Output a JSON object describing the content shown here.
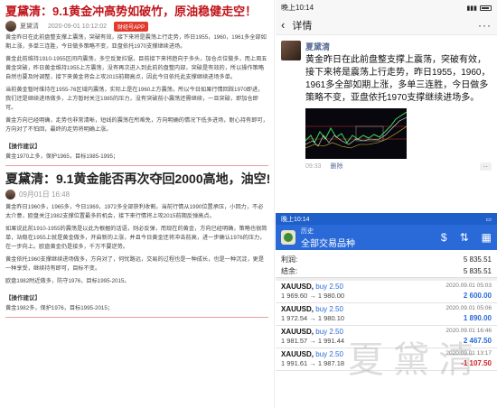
{
  "article1": {
    "title": "夏黛清：9.1黄金冲高势如破竹，原油稳健走空！",
    "author": "夏黛清",
    "date": "2020-09-01 10:12:02",
    "badge": "财经号APP",
    "paragraphs": [
      "黄金昨日在此前盘整支撑上震荡，突破有效，接下来将是震荡上行走势，昨日1955，1960，1961多全部如期上涨，多单三连胜，今日做多策略不变，亚盘依托1970支撑继续进场。",
      "黄金此前维持1910-1955区间内震荡，多空反复拉锯，目前接下来将趋向于多头，加仓点位做多，而上周五黄金突破，昨日黄金维持1955上方震荡，没有再次进入到此前的盘整内部，突破是有效的，所以操作策略自然也要及时调整，接下来黄金将会上攻2015前期高点，因此今日依托此支撑继续进场多单。",
      "当前黄金暂时维持在1955-76区域内震荡，实际上是在1960上方震荡，所以今日如果行情回踩1970即进，我们还是继续进场做多，上方暂时关注1985的压力，没有突破前小震荡还需继续，一旦突破，即加仓即可。",
      "黄金方向已经明确，走势也非常清晰，短线的震荡在所难免，方向明确的情况下低多进场，耐心持有即可，方向对了不怕回，最终的走势将明确上涨。"
    ],
    "ops_heading": "【操作建议】",
    "ops_text": "黄金1970上多，保护1965，目标1985-1995；"
  },
  "article2": {
    "title": "夏黛清：9.1黄金能否再次夺回2000高地，油空!",
    "date": "09月01日 16:48",
    "paragraphs": [
      "黄金昨日1960多，1965多，今日1969，1972多全部获利收割。当前行情从1990位置承压，小回力，不必太介意，欧盘关注1982支撑位置最多的机会，接下来行情将上攻2015前期反弹高点。",
      "如果说此前1910-1955的震荡是以此为根据的话语，则必反弹，而现在的黄金，方向已经明确，策略也很简单，站稳在1955上就是黄金做多，开启新的上涨，并且今日黄金还将冲击前高，进一步确认1976的压力，在一步向上。欧盘黄金仍是接多，千万不要逆势。",
      "黄金依托1960支撑继续进场做多，方向对了，何忧路远，交易的过程也是一种成长，也是一种沉淀，更是一种享受，继续持有即可，目标不变。",
      "欧盘1982附近做多，防守1976，目标1995-2015。"
    ],
    "ops_heading": "【操作建议】",
    "ops_text": "黄金1982多，保护1976，目标1995-2015；"
  },
  "moment": {
    "status_time": "晚上10:14",
    "nav_title": "详情",
    "name": "夏黛清",
    "text": "黄金昨日在此前盘整支撑上震荡，突破有效，接下来将是震荡上行走势，昨日1955，1960，1961多全部如期上涨，多单三连胜，今日做多策略不变，亚盘依托1970支撑继续进场多。",
    "time": "09:33",
    "delete_label": "删除"
  },
  "mt4": {
    "status_time": "晚上10:14",
    "title_small": "历史",
    "title_main": "全部交易品种",
    "summary": [
      {
        "label": "利润:",
        "value": "5 835.51"
      },
      {
        "label": "结余:",
        "value": "5 835.51"
      }
    ],
    "trades": [
      {
        "symbol": "XAUUSD,",
        "side": "buy 2.50",
        "prices": "1 969.60 → 1 980.00",
        "datetime": "2020.09.01 05:03",
        "pl": "2 600.00",
        "neg": false
      },
      {
        "symbol": "XAUUSD,",
        "side": "buy 2.50",
        "prices": "1 972.54 → 1 980.10",
        "datetime": "2020.09.01 05:06",
        "pl": "1 890.00",
        "neg": false
      },
      {
        "symbol": "XAUUSD,",
        "side": "buy 2.50",
        "prices": "1 981.57 → 1 991.44",
        "datetime": "2020.09.01 16:46",
        "pl": "2 467.50",
        "neg": false
      },
      {
        "symbol": "XAUUSD,",
        "side": "buy 2.50",
        "prices": "1 991.61 → 1 987.18",
        "datetime": "2020.09.01 13:17",
        "pl": "-1 107.50",
        "neg": true
      }
    ],
    "watermark": "夏黛清"
  },
  "colors": {
    "title_red": "#c0141a",
    "mt_blue": "#2a6ad8",
    "loss_red": "#cc2222"
  }
}
